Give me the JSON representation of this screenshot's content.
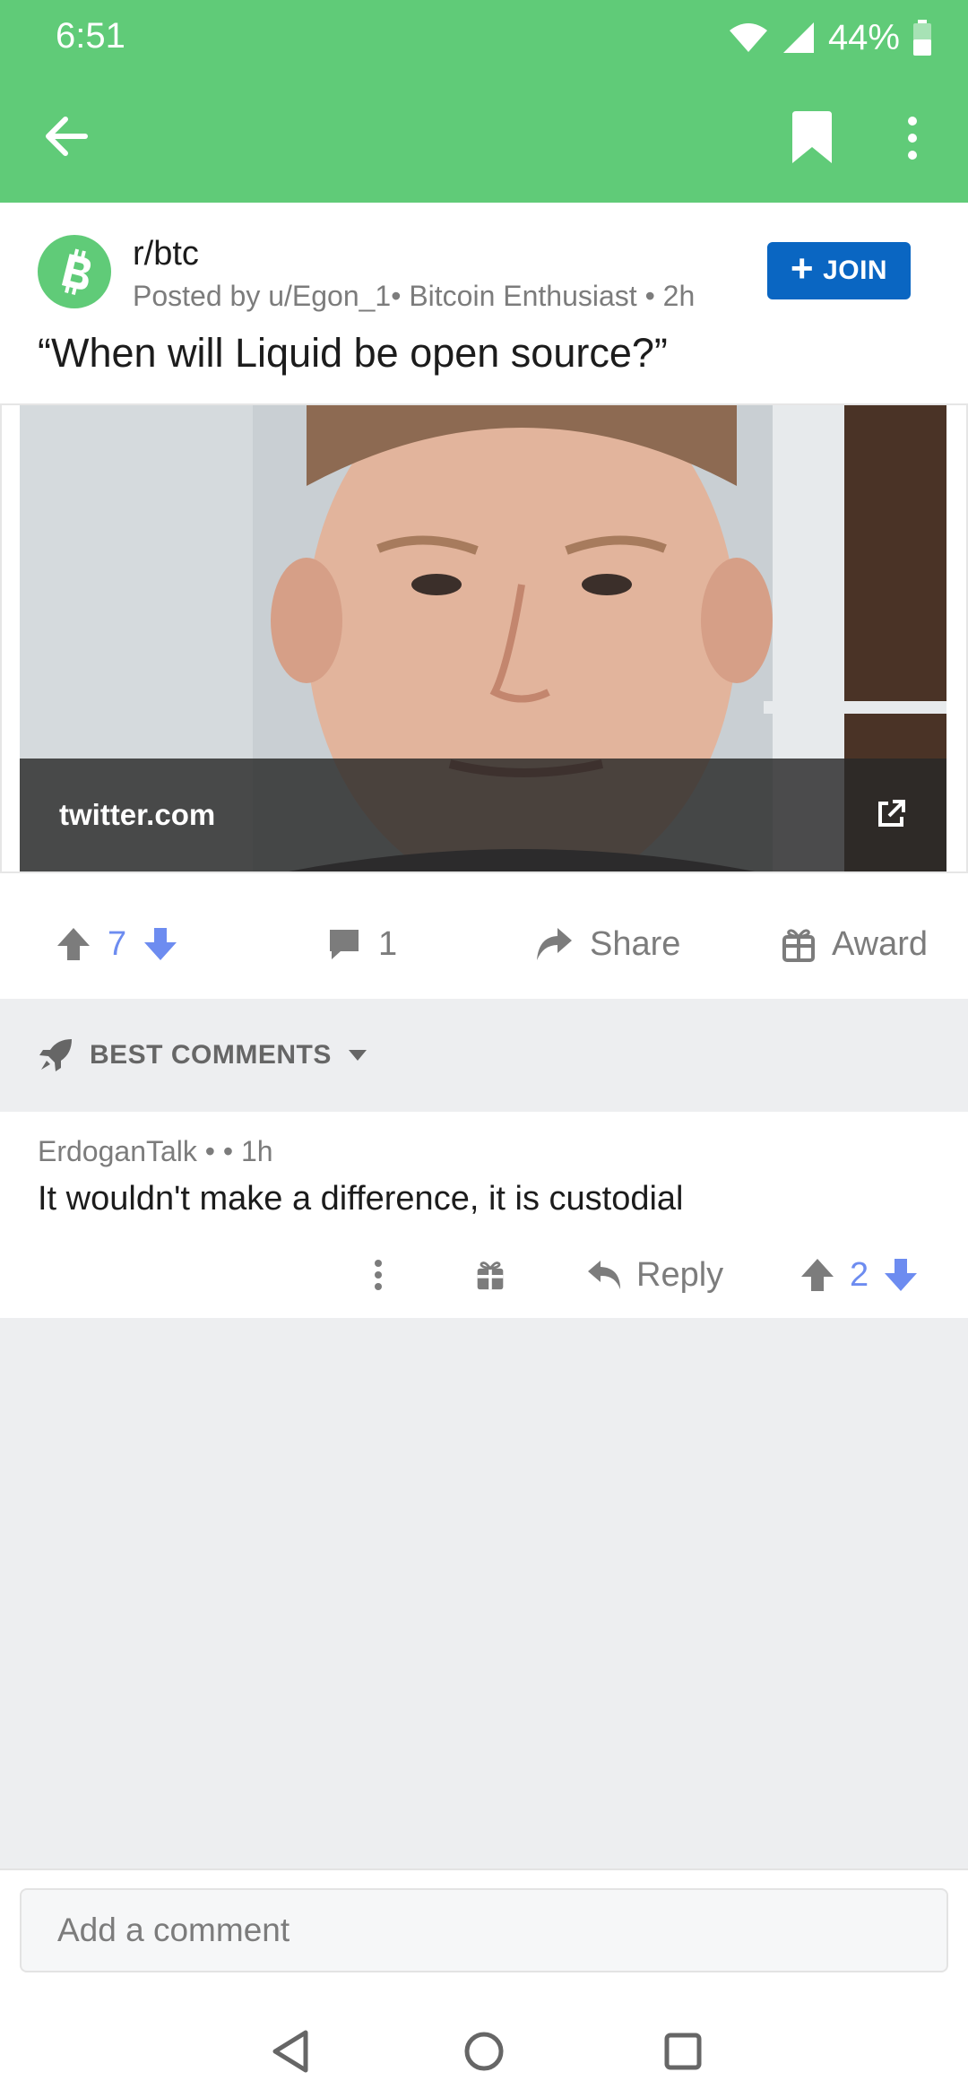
{
  "status_bar": {
    "time": "6:51",
    "battery": "44%"
  },
  "app_bar": {
    "back_icon": "arrow-left-icon",
    "bookmark_icon": "bookmark-icon",
    "more_icon": "more-vertical-icon"
  },
  "colors": {
    "brand_green": "#60cb78",
    "join_blue": "#0a66c2",
    "vote_blue": "#6d8cf0",
    "muted": "#7c7c7c"
  },
  "post": {
    "subreddit": "r/btc",
    "meta": "Posted by u/Egon_1• Bitcoin Enthusiast • 2h",
    "join_label": "JOIN",
    "title": "“When will Liquid be open source?”",
    "link_domain": "twitter.com",
    "votes": "7",
    "comments": "1",
    "share_label": "Share",
    "award_label": "Award"
  },
  "comments_header": {
    "sort_label": "BEST COMMENTS"
  },
  "comments": [
    {
      "meta": "ErdoganTalk • • 1h",
      "body": "It wouldn't make a difference, it is custodial",
      "reply_label": "Reply",
      "votes": "2"
    }
  ],
  "composer": {
    "placeholder": "Add a comment"
  }
}
